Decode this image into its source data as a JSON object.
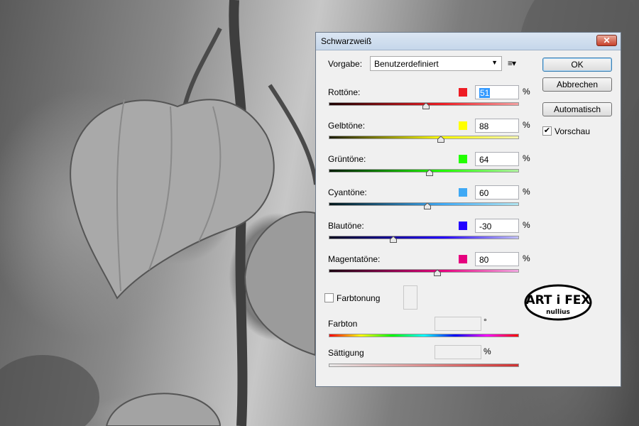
{
  "dialog": {
    "title": "Schwarzweiß",
    "close_label": "✕",
    "preset": {
      "label": "Vorgabe:",
      "value": "Benutzerdefiniert"
    },
    "buttons": {
      "ok": "OK",
      "cancel": "Abbrechen",
      "auto": "Automatisch"
    },
    "preview": {
      "label": "Vorschau",
      "checked": true
    },
    "channels": [
      {
        "label": "Rottöne:",
        "value": "51",
        "color": "#ee1c24",
        "track_from": "#1a0000",
        "track_to": "#f2a0a0",
        "fraction": 0.51
      },
      {
        "label": "Gelbtöne:",
        "value": "88",
        "color": "#ffff00",
        "track_from": "#1a1a00",
        "track_to": "#fafab0",
        "fraction": 0.59
      },
      {
        "label": "Grüntöne:",
        "value": "64",
        "color": "#22ff00",
        "track_from": "#001a00",
        "track_to": "#b0f0a0",
        "fraction": 0.53
      },
      {
        "label": "Cyantöne:",
        "value": "60",
        "color": "#3fa9f5",
        "track_from": "#001518",
        "track_to": "#b0e4f0",
        "fraction": 0.52
      },
      {
        "label": "Blautöne:",
        "value": "-30",
        "color": "#2200ff",
        "track_from": "#00001a",
        "track_to": "#c0c0f8",
        "fraction": 0.34
      },
      {
        "label": "Magentatöne:",
        "value": "80",
        "color": "#e6007e",
        "track_from": "#1a0010",
        "track_to": "#f0a8e0",
        "fraction": 0.57
      }
    ],
    "percent": "%",
    "tint": {
      "label": "Farbtonung",
      "checked": false
    },
    "hue": {
      "label": "Farbton",
      "unit": "°"
    },
    "saturation": {
      "label": "Sättigung",
      "unit": "%"
    },
    "logo": {
      "line1": "ART i FEX",
      "line2": "nullius"
    }
  }
}
